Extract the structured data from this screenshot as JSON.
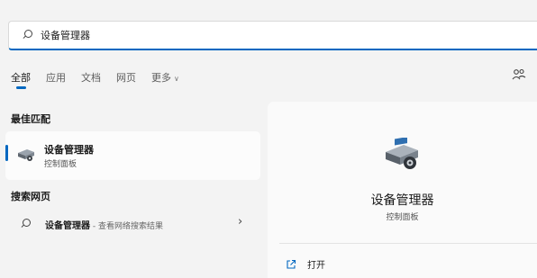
{
  "search": {
    "query": "设备管理器"
  },
  "tabs": [
    {
      "label": "全部",
      "active": true
    },
    {
      "label": "应用"
    },
    {
      "label": "文档"
    },
    {
      "label": "网页"
    },
    {
      "label": "更多"
    }
  ],
  "sections": {
    "best_match": "最佳匹配",
    "web": "搜索网页"
  },
  "best_match": {
    "title": "设备管理器",
    "subtitle": "控制面板"
  },
  "web_result": {
    "title": "设备管理器",
    "subtitle": " - 查看网络搜索结果"
  },
  "detail": {
    "title": "设备管理器",
    "subtitle": "控制面板",
    "open_label": "打开"
  },
  "colors": {
    "accent": "#0067c0",
    "background": "#f3f3f3",
    "panel": "#fafafa"
  },
  "icons": [
    "search-icon",
    "share-icon",
    "device-manager-icon",
    "chevron-right-icon",
    "chevron-down-icon",
    "open-external-icon"
  ]
}
